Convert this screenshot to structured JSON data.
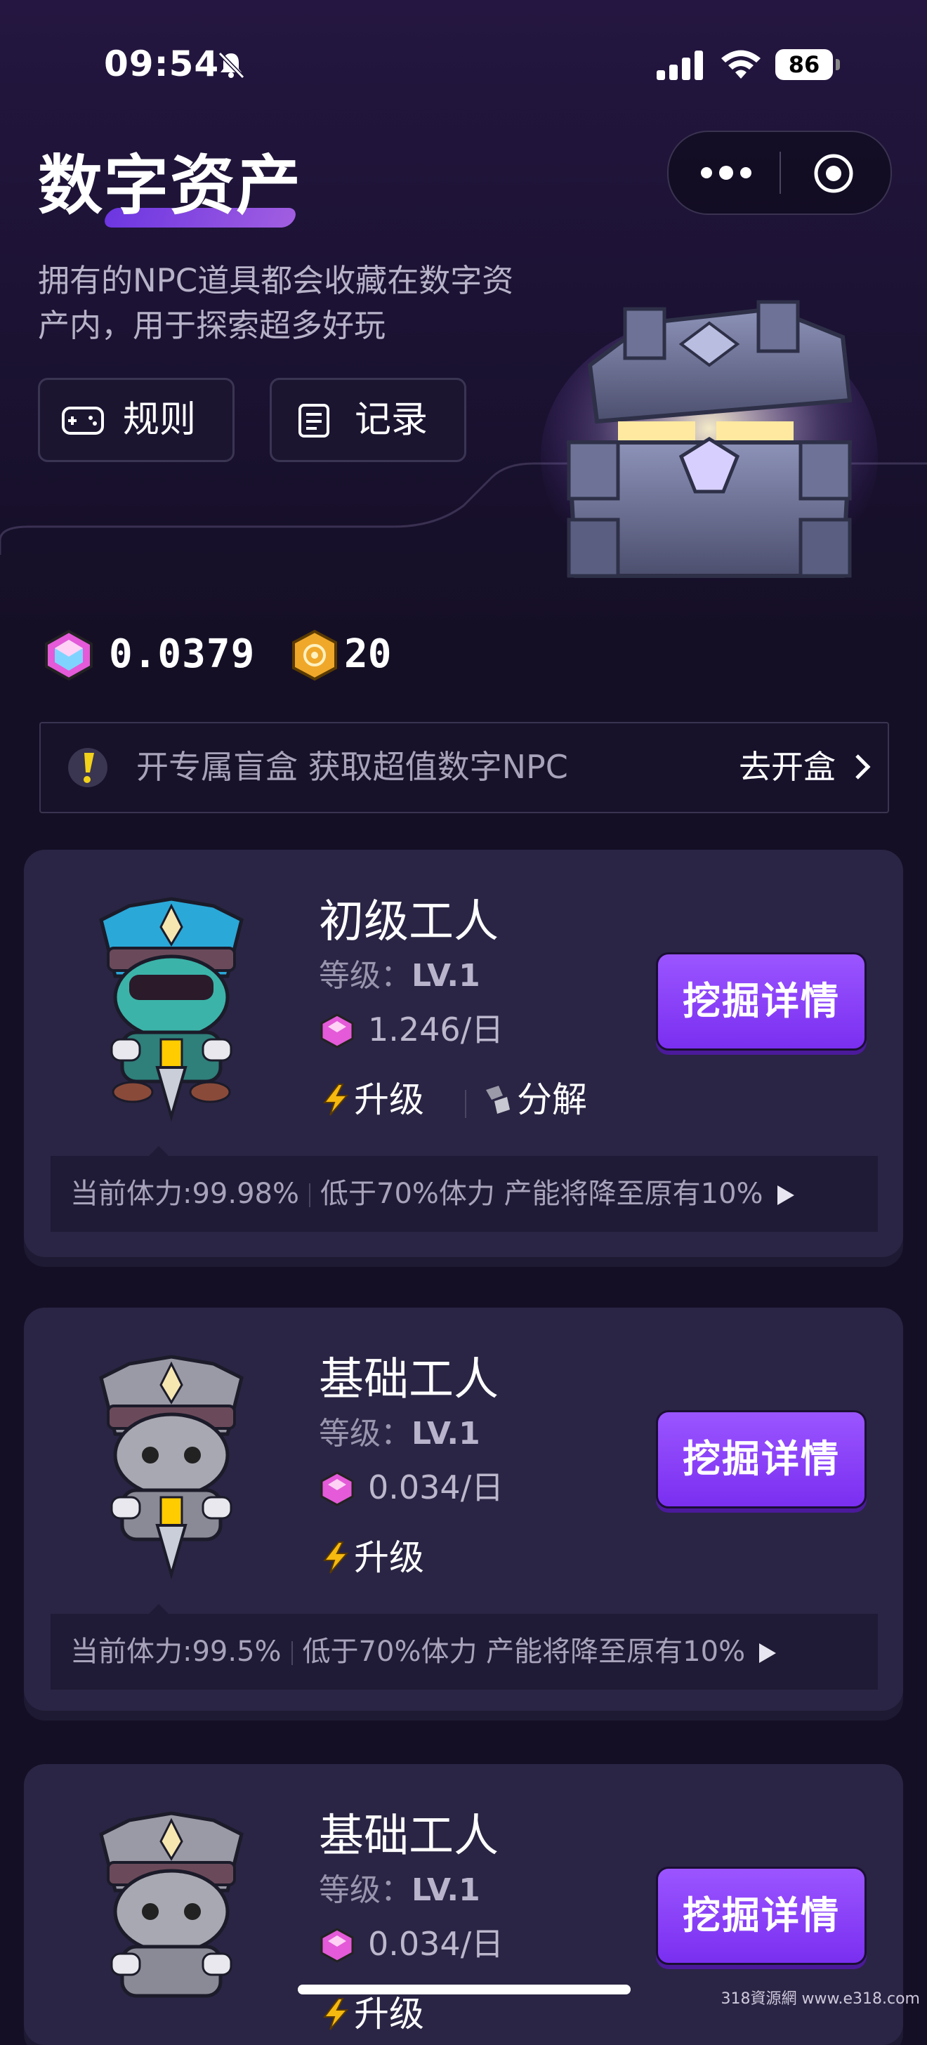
{
  "status_bar": {
    "time": "09:54",
    "battery": "86"
  },
  "header": {
    "title": "数字资产",
    "description": "拥有的NPC道具都会收藏在数字资产内，用于探索超多好玩",
    "rules_label": "规则",
    "records_label": "记录"
  },
  "balances": {
    "gem": "0.0379",
    "coin": "20"
  },
  "notice": {
    "text": "开专属盲盒 获取超值数字NPC",
    "link": "去开盒"
  },
  "cards": [
    {
      "name": "初级工人",
      "level_label": "等级：",
      "level": "LV.1",
      "rate": "1.246/日",
      "upgrade": "升级",
      "disassemble": "分解",
      "button": "挖掘详情",
      "stamina": "当前体力:99.98%",
      "note": "低于70%体力 产能将降至原有10%",
      "hat_color": "#2aa8d8"
    },
    {
      "name": "基础工人",
      "level_label": "等级：",
      "level": "LV.1",
      "rate": "0.034/日",
      "upgrade": "升级",
      "button": "挖掘详情",
      "stamina": "当前体力:99.5%",
      "note": "低于70%体力 产能将降至原有10%",
      "hat_color": "#9a9aa6"
    },
    {
      "name": "基础工人",
      "level_label": "等级：",
      "level": "LV.1",
      "rate": "0.034/日",
      "upgrade": "升级",
      "button": "挖掘详情",
      "hat_color": "#9a9aa6"
    }
  ],
  "watermark": "318資源網 www.e318.com",
  "colors": {
    "accent": "#8a3fff",
    "background": "#150f26",
    "card": "#2a2544"
  }
}
